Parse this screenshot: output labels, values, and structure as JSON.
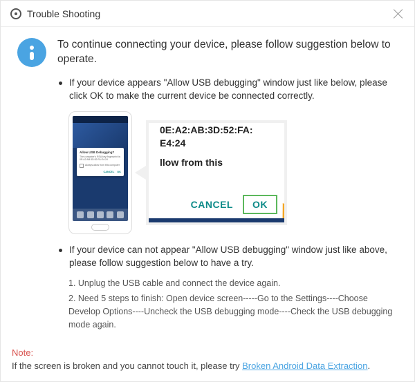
{
  "title": "Trouble Shooting",
  "intro": "To continue connecting your device, please follow suggestion below to operate.",
  "items": [
    {
      "text": "If your device appears \"Allow USB debugging\" window just like below, please click OK to make the current device  be connected correctly."
    },
    {
      "text": "If your device can not appear \"Allow USB debugging\" window just like above, please follow suggestion below to have a try."
    }
  ],
  "phone_dialog": {
    "title": "Allow USB Debugging?",
    "body1": "The computer's RSA key fingerprint is:",
    "body2": "0E:A2:AB:3D:52:FA:E4:24",
    "checkbox": "Always allow from this computer",
    "cancel": "CANCEL",
    "ok": "OK"
  },
  "zoom": {
    "mac1": "0E:A2:AB:3D:52:FA:",
    "mac2": "E4:24",
    "msg": "llow from this",
    "cancel": "CANCEL",
    "ok": "OK"
  },
  "steps": {
    "s1": "1. Unplug the USB cable and connect the device again.",
    "s2": "2. Need 5 steps to finish: Open device screen-----Go to the Settings----Choose Develop Options----Uncheck the USB debugging mode----Check the USB debugging mode again."
  },
  "footer": {
    "note": "Note:",
    "text": "If the screen is broken and you cannot touch it, please try ",
    "link": "Broken Android Data Extraction",
    "period": "."
  }
}
